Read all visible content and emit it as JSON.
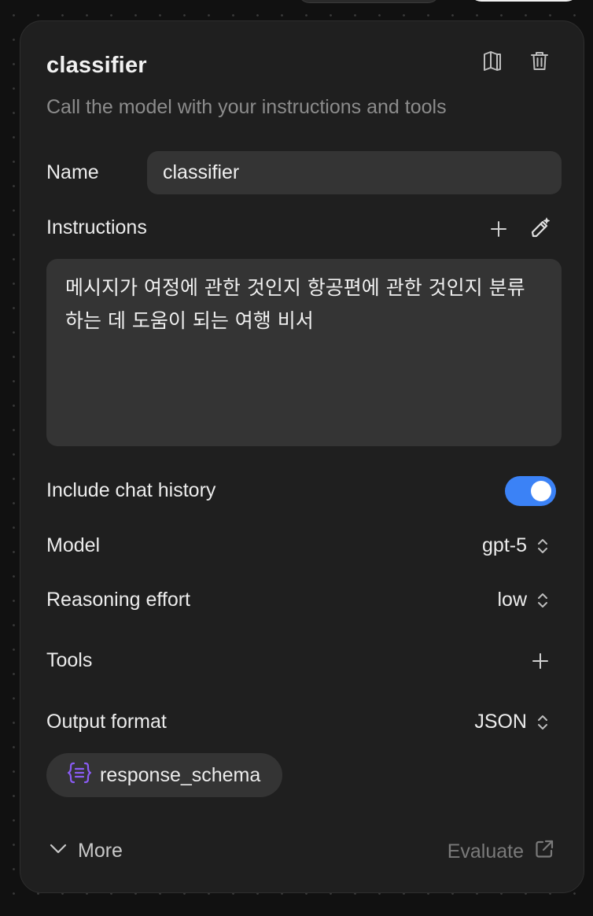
{
  "node": {
    "title": "classifier",
    "subtitle": "Call the model with your instructions and tools"
  },
  "name_field": {
    "label": "Name",
    "value": "classifier"
  },
  "instructions": {
    "label": "Instructions",
    "value": "메시지가 여정에 관한 것인지 항공편에 관한 것인지 분류하는 데 도움이 되는 여행 비서"
  },
  "chat_history": {
    "label": "Include chat history",
    "enabled": true
  },
  "model": {
    "label": "Model",
    "value": "gpt-5"
  },
  "reasoning": {
    "label": "Reasoning effort",
    "value": "low"
  },
  "tools": {
    "label": "Tools"
  },
  "output_format": {
    "label": "Output format",
    "value": "JSON",
    "schema_chip": "response_schema"
  },
  "footer": {
    "more_label": "More",
    "evaluate_label": "Evaluate"
  },
  "colors": {
    "toggle_on": "#3b82f6",
    "schema_icon": "#8b5cf6",
    "panel_bg": "#1f1f1f"
  },
  "icons": {
    "docs": "book-open-icon",
    "delete": "trash-icon",
    "add": "plus-icon",
    "generate": "magic-pen-icon",
    "select": "chevron-up-down-icon",
    "schema": "braces-icon",
    "more": "chevron-down-icon",
    "evaluate": "external-link-icon"
  }
}
